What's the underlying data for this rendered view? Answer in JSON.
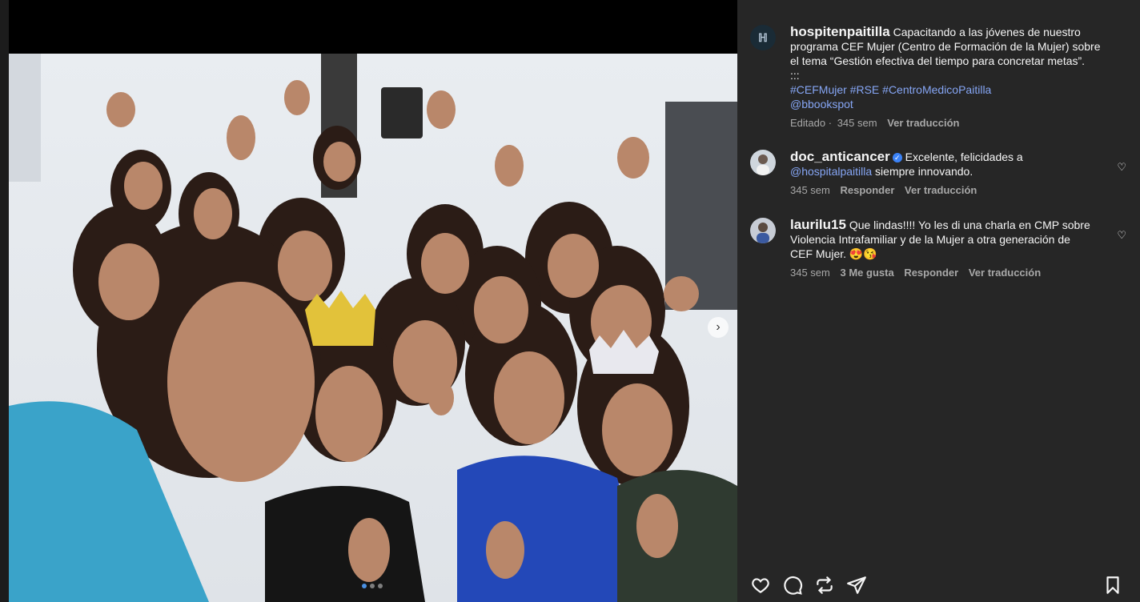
{
  "post": {
    "author": "hospitenpaitilla",
    "caption_line1": "Capacitando a las jóvenes de nuestro",
    "caption_line2": "programa CEF Mujer (Centro de Formación de la Mujer) sobre",
    "caption_line3": "el tema “Gestión efectiva del tiempo para concretar metas”.",
    "caption_line4": ":::",
    "hashtags": [
      "#CEFMujer",
      "#RSE",
      "#CentroMedicoPaitilla"
    ],
    "mention": "@bbookspot",
    "edited": "Editado",
    "sep": "·",
    "time": "345 sem",
    "translate": "Ver traducción"
  },
  "comments": [
    {
      "user": "doc_anticancer",
      "verified": true,
      "text_line1": "Excelente, felicidades a",
      "mention": "@hospitalpaitilla",
      "text_after": " siempre innovando.",
      "time": "345 sem",
      "reply": "Responder",
      "translate": "Ver traducción"
    },
    {
      "user": "laurilu15",
      "text_line1": "Que lindas!!!! Yo les di una charla en CMP sobre",
      "text_line2": "Violencia Intrafamiliar y de la Mujer a otra generación de",
      "text_line3": "CEF Mujer. 😍😘",
      "time": "345 sem",
      "likes": "3 Me gusta",
      "reply": "Responder",
      "translate": "Ver traducción"
    }
  ],
  "icons": {
    "like": "heart-icon",
    "comment": "comment-icon",
    "repost": "repost-icon",
    "share": "send-icon",
    "save": "bookmark-icon",
    "next": "chevron-right-icon"
  },
  "colors": {
    "panel_bg": "#262626",
    "link_blue": "#86a6f5",
    "meta_gray": "#a8a8a8",
    "verified": "#3b82f6"
  }
}
